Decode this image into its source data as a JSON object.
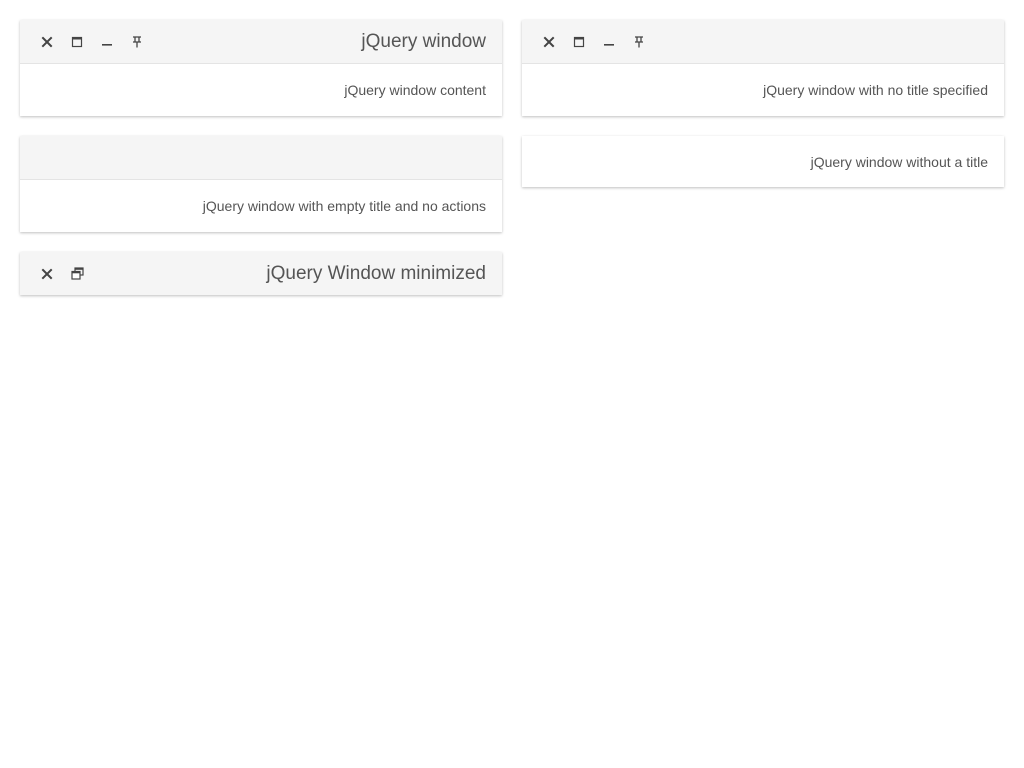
{
  "windows": {
    "w1": {
      "title": "jQuery window",
      "content": "jQuery window content",
      "actions": [
        "close-icon",
        "maximize-icon",
        "minimize-icon",
        "pin-icon"
      ]
    },
    "w2": {
      "title": "",
      "content": "jQuery window with no title specified",
      "actions": [
        "close-icon",
        "maximize-icon",
        "minimize-icon",
        "pin-icon"
      ]
    },
    "w3": {
      "title": "",
      "content": "jQuery window with empty title and no actions",
      "actions": []
    },
    "w4": {
      "content": "jQuery window without a title"
    },
    "w5": {
      "title": "jQuery Window minimized",
      "actions": [
        "close-icon",
        "restore-icon"
      ],
      "state": "minimized"
    }
  },
  "colors": {
    "titlebar_bg": "#f5f5f5",
    "text": "#555555",
    "icon": "#444444",
    "background": "#ffffff"
  }
}
